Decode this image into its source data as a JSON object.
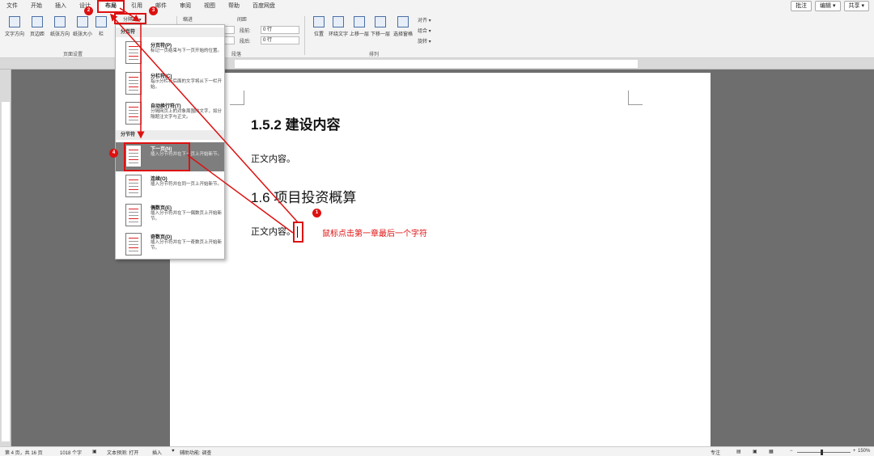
{
  "menu": {
    "tabs": [
      "文件",
      "开始",
      "插入",
      "设计",
      "布局",
      "引用",
      "邮件",
      "审阅",
      "视图",
      "帮助",
      "百度网盘"
    ],
    "right_buttons": [
      "批注",
      "编辑 ▾",
      "共享 ▾"
    ]
  },
  "ribbon": {
    "page_setup": {
      "buttons": [
        "文字方向",
        "页边距",
        "纸张方向",
        "纸张大小",
        "栏"
      ],
      "group_label": "页面设置",
      "breaks_button": "分隔符 ▾"
    },
    "paragraph": {
      "indent_header": "缩进",
      "spacing_header": "间距",
      "before_label": "段前:",
      "before_value": "0 行",
      "after_label": "段后:",
      "after_value": "0 行",
      "group_label": "段落"
    },
    "arrange": {
      "buttons": [
        "位置",
        "环绕文字",
        "上移一层",
        "下移一层",
        "选择窗格"
      ],
      "align": "对齐 ▾",
      "group": "组合 ▾",
      "rotate": "旋转 ▾",
      "group_label": "排列"
    }
  },
  "dropdown": {
    "section1": "分页符",
    "section2": "分节符",
    "items": [
      {
        "title": "分页符(P)",
        "desc": "标记一页结束与下一页开始的位置。"
      },
      {
        "title": "分栏符(C)",
        "desc": "指示分栏符后面的文字将从下一栏开始。"
      },
      {
        "title": "自动换行符(T)",
        "desc": "分隔网页上的对象周围的文字，如分隔题注文字与正文。"
      },
      {
        "title": "下一页(N)",
        "desc": "插入分节符并在下一页上开始新节。"
      },
      {
        "title": "连续(O)",
        "desc": "插入分节符并在同一页上开始新节。"
      },
      {
        "title": "偶数页(E)",
        "desc": "插入分节符并在下一偶数页上开始新节。"
      },
      {
        "title": "奇数页(D)",
        "desc": "插入分节符并在下一奇数页上开始新节。"
      }
    ]
  },
  "document": {
    "heading1": "1.5.2 建设内容",
    "para1": "正文内容。",
    "heading2": "1.6  项目投资概算",
    "para2": "正文内容。",
    "annotation": "鼠标点击第一章最后一个字符"
  },
  "markers": [
    "1",
    "2",
    "3",
    "4"
  ],
  "status": {
    "page": "第 4 页，共 16 页",
    "words": "1018 个字",
    "prediction": "文本预测: 打开",
    "insert": "插入",
    "accessibility": "辅助功能: 调查",
    "focus": "专注",
    "zoom": "150%"
  },
  "colors": {
    "annotation_red": "#dd1111",
    "page_bg": "#ffffff",
    "canvas_bg": "#6e6e6e"
  }
}
